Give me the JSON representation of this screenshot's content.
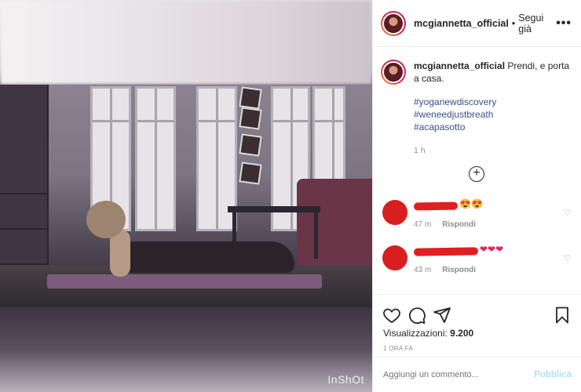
{
  "media": {
    "watermark": "InShOt"
  },
  "header": {
    "username": "mcgiannetta_official",
    "separator": "•",
    "follow_label": "Segui già",
    "more_label": "•••"
  },
  "caption": {
    "username": "mcgiannetta_official",
    "text": "Prendi, e porta a casa.",
    "hashtags": [
      "#yoganewdiscovery",
      "#weneedjustbreath",
      "#acapasotto"
    ],
    "time": "1 h",
    "load_more_label": "+"
  },
  "comments": [
    {
      "emojis": "😍😍",
      "time": "47 m",
      "reply_label": "Rispondi",
      "like_icon": "heart-outline"
    },
    {
      "emojis": "❤❤❤",
      "time": "43 m",
      "reply_label": "Rispondi",
      "like_icon": "heart-outline"
    }
  ],
  "footer": {
    "views_label": "Visualizzazioni:",
    "views_count": "9.200",
    "post_time": "1 ORA FA",
    "comment_placeholder": "Aggiungi un commento...",
    "publish_label": "Pubblica"
  },
  "colors": {
    "link": "#385185",
    "muted": "#8e8e8e",
    "publish_disabled": "#b2dffc",
    "redaction": "#e02020"
  }
}
